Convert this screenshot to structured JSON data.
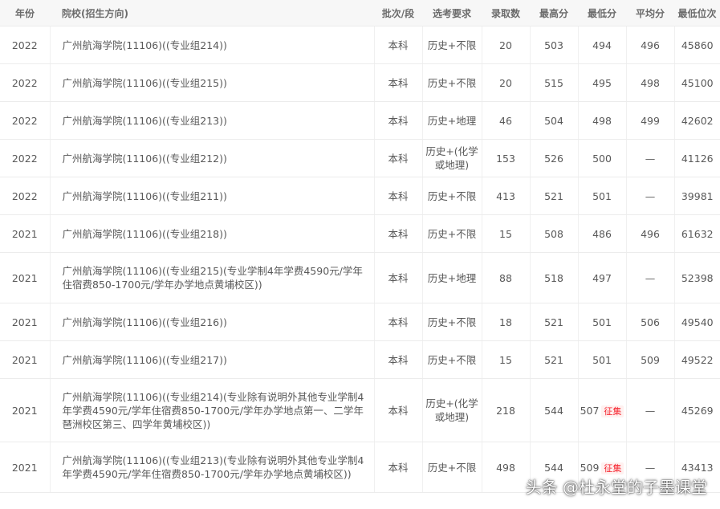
{
  "table": {
    "headers": {
      "year": "年份",
      "school": "院校(招生方向)",
      "batch": "批次/段",
      "subjects": "选考要求",
      "enrolled": "录取数",
      "max": "最高分",
      "min": "最低分",
      "avg": "平均分",
      "rank": "最低位次"
    },
    "rows": [
      {
        "year": "2022",
        "school": "广州航海学院(11106)((专业组214))",
        "batch": "本科",
        "subjects": "历史+不限",
        "enrolled": "20",
        "max": "503",
        "min": "494",
        "tag": "",
        "avg": "496",
        "rank": "45860"
      },
      {
        "year": "2022",
        "school": "广州航海学院(11106)((专业组215))",
        "batch": "本科",
        "subjects": "历史+不限",
        "enrolled": "20",
        "max": "515",
        "min": "495",
        "tag": "",
        "avg": "498",
        "rank": "45100"
      },
      {
        "year": "2022",
        "school": "广州航海学院(11106)((专业组213))",
        "batch": "本科",
        "subjects": "历史+地理",
        "enrolled": "46",
        "max": "504",
        "min": "498",
        "tag": "",
        "avg": "499",
        "rank": "42602"
      },
      {
        "year": "2022",
        "school": "广州航海学院(11106)((专业组212))",
        "batch": "本科",
        "subjects": "历史+(化学或地理)",
        "enrolled": "153",
        "max": "526",
        "min": "500",
        "tag": "",
        "avg": "—",
        "rank": "41126"
      },
      {
        "year": "2022",
        "school": "广州航海学院(11106)((专业组211))",
        "batch": "本科",
        "subjects": "历史+不限",
        "enrolled": "413",
        "max": "521",
        "min": "501",
        "tag": "",
        "avg": "—",
        "rank": "39981"
      },
      {
        "year": "2021",
        "school": "广州航海学院(11106)((专业组218))",
        "batch": "本科",
        "subjects": "历史+不限",
        "enrolled": "15",
        "max": "508",
        "min": "486",
        "tag": "",
        "avg": "496",
        "rank": "61632"
      },
      {
        "year": "2021",
        "school": "广州航海学院(11106)((专业组215)(专业学制4年学费4590元/学年住宿费850-1700元/学年办学地点黄埔校区))",
        "batch": "本科",
        "subjects": "历史+地理",
        "enrolled": "88",
        "max": "518",
        "min": "497",
        "tag": "",
        "avg": "—",
        "rank": "52398"
      },
      {
        "year": "2021",
        "school": "广州航海学院(11106)((专业组216))",
        "batch": "本科",
        "subjects": "历史+不限",
        "enrolled": "18",
        "max": "521",
        "min": "501",
        "tag": "",
        "avg": "506",
        "rank": "49540"
      },
      {
        "year": "2021",
        "school": "广州航海学院(11106)((专业组217))",
        "batch": "本科",
        "subjects": "历史+不限",
        "enrolled": "15",
        "max": "521",
        "min": "501",
        "tag": "",
        "avg": "509",
        "rank": "49522"
      },
      {
        "year": "2021",
        "school": "广州航海学院(11106)((专业组214)(专业除有说明外其他专业学制4年学费4590元/学年住宿费850-1700元/学年办学地点第一、二学年琶洲校区第三、四学年黄埔校区))",
        "batch": "本科",
        "subjects": "历史+(化学或地理)",
        "enrolled": "218",
        "max": "544",
        "min": "507",
        "tag": "征集",
        "avg": "—",
        "rank": "45269"
      },
      {
        "year": "2021",
        "school": "广州航海学院(11106)((专业组213)(专业除有说明外其他专业学制4年学费4590元/学年住宿费850-1700元/学年办学地点黄埔校区))",
        "batch": "本科",
        "subjects": "历史+不限",
        "enrolled": "498",
        "max": "544",
        "min": "509",
        "tag": "征集",
        "avg": "—",
        "rank": "43413"
      }
    ]
  },
  "watermark": "头条 @杜永堂的子墨课堂"
}
